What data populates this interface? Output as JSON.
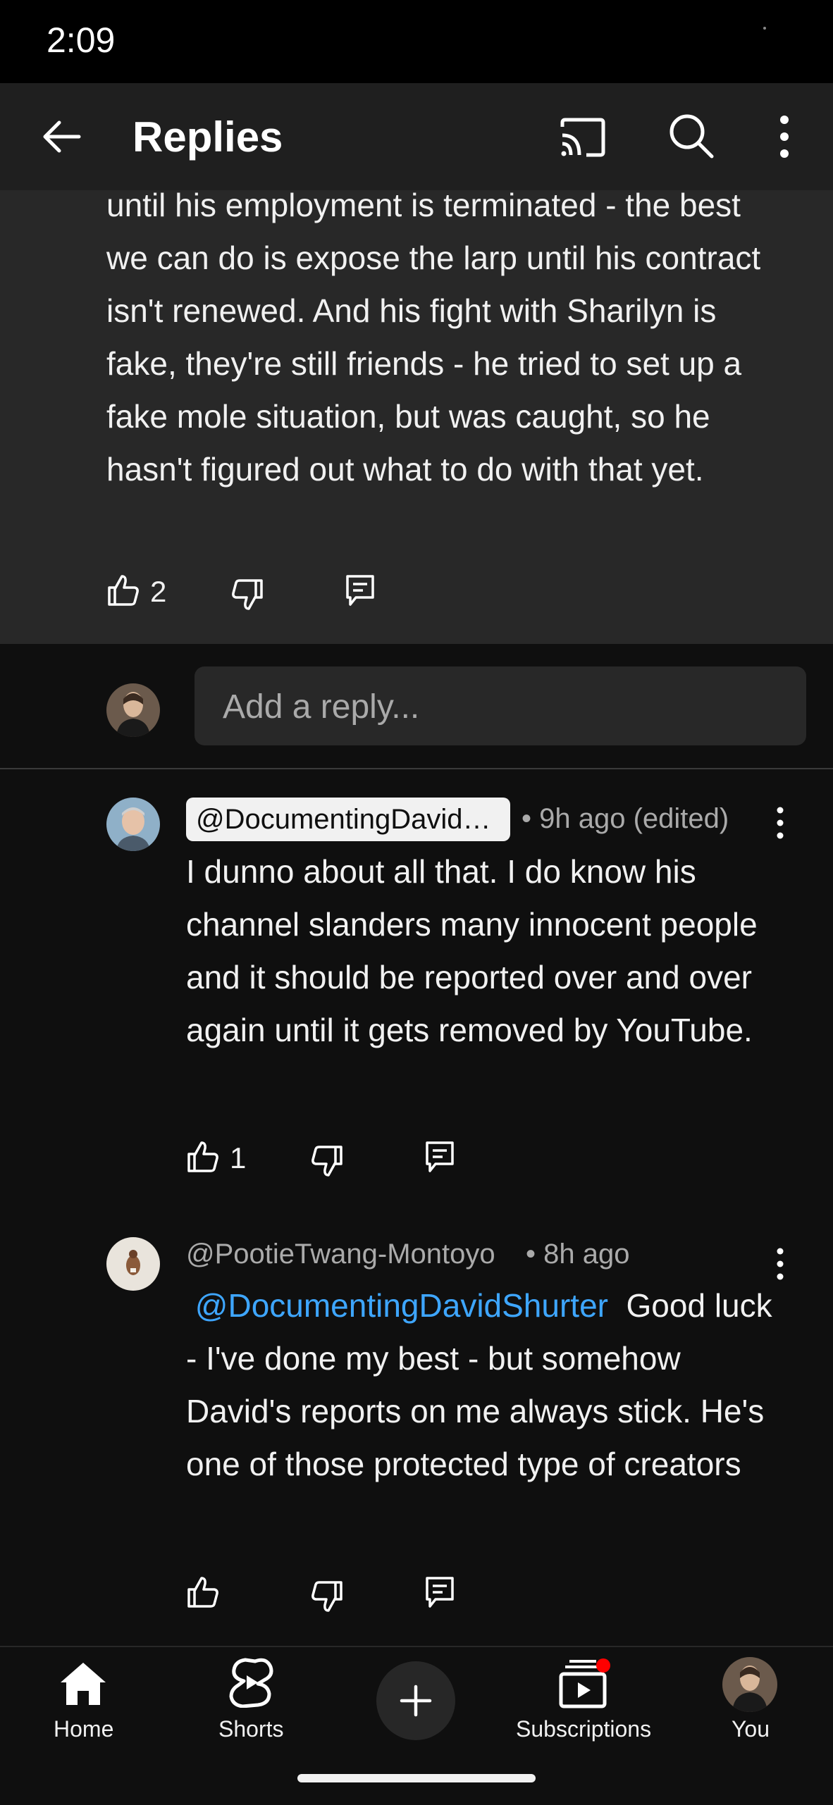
{
  "status_bar": {
    "time": "2:09"
  },
  "app_bar": {
    "title": "Replies"
  },
  "parent_comment": {
    "text": "until his employment is terminated - the best we can do is expose the larp until his contract isn't renewed. And his fight with Sharilyn is fake, they're still friends - he tried to set up a fake mole situation, but was caught, so he hasn't figured out what to do with that yet.",
    "likes": "2"
  },
  "reply_input": {
    "placeholder": "Add a reply..."
  },
  "comments": [
    {
      "author": "@DocumentingDavid…",
      "meta": "• 9h ago (edited)",
      "text": "I dunno about all that. I do know his channel slanders many innocent people and it should be reported over and over again until it gets removed by YouTube.",
      "likes": "1"
    },
    {
      "author": "@PootieTwang-Montoyo",
      "meta": "• 8h ago",
      "mention": "@DocumentingDavidShurter",
      "text": "Good luck - I've done my best - but somehow David's reports on me always stick. He's one of those protected type of creators",
      "likes": ""
    }
  ],
  "bottom_nav": {
    "home": "Home",
    "shorts": "Shorts",
    "subscriptions": "Subscriptions",
    "you": "You"
  },
  "colors": {
    "background": "#0f0f0f",
    "highlight_bg": "#282828",
    "mention": "#3ea6ff",
    "notification_dot": "#ff0000"
  }
}
